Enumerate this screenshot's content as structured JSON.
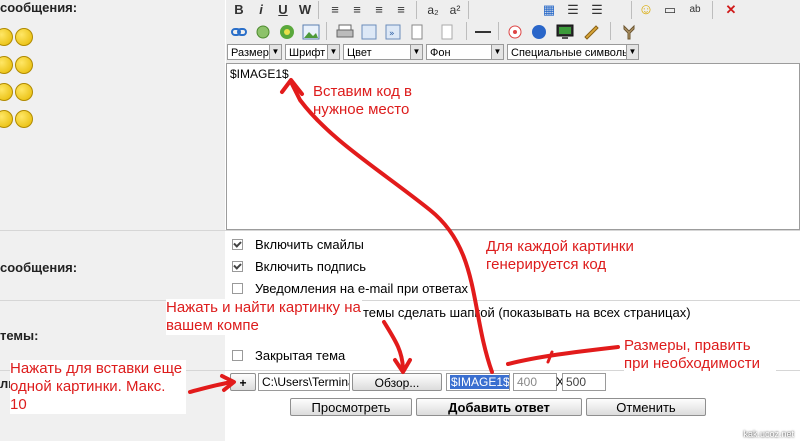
{
  "labels": {
    "message": "сообщения:",
    "message_options": "сообщения:",
    "topic": "темы:",
    "attach": "ли"
  },
  "toolbar": {
    "row1": [
      "B",
      "i",
      "U",
      "W",
      "≡",
      "≡",
      "≡",
      "≡",
      "a₂",
      "a²",
      "▦",
      "☰",
      "☰",
      "☺",
      "▭",
      "ab",
      "✕"
    ],
    "selects": [
      "Размер",
      "Шрифт",
      "Цвет",
      "Фон",
      "Специальные символы"
    ]
  },
  "editor": {
    "content": "$IMAGE1$"
  },
  "options": {
    "enable_smilies": "Включить смайлы",
    "enable_signature": "Включить подпись",
    "notify_email": "Уведомления на e-mail при ответах",
    "sticky_topic": "темы сделать шапкой (показывать на всех страницах)",
    "closed_topic": "Закрытая тема"
  },
  "attach": {
    "add_label": "+",
    "path_value": "C:\\Users\\Terminal\\Des",
    "browse_label": "Обзор...",
    "code_value": "$IMAGE1$",
    "width_value": "400",
    "x_label": "X",
    "height_value": "500"
  },
  "buttons": {
    "preview": "Просмотреть",
    "submit": "Добавить ответ",
    "cancel": "Отменить"
  },
  "annotations": {
    "insert_code": "Вставим код в нужное место",
    "code_generated": "Для каждой картинки генерируется код",
    "browse_hint": "Нажать и найти картинку на вашем компе",
    "sizes_hint": "Размеры, править при необходимости",
    "add_more_hint": "Нажать для вставки еще одной картинки. Макс. 10"
  },
  "watermark": "kak.ucoz.net",
  "colors": {
    "annotation": "#dd1c1c",
    "code_highlight": "#3a6fd0"
  }
}
